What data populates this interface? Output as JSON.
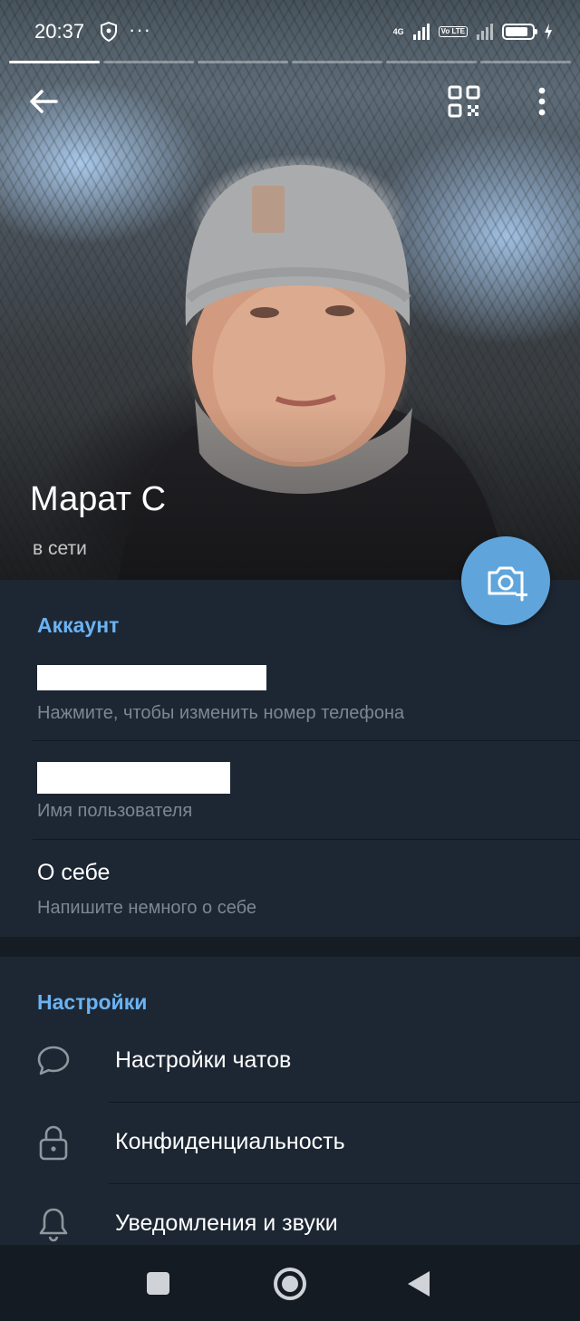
{
  "status_bar": {
    "time": "20:37",
    "more_indicator": "···",
    "network_1": "4G",
    "volte": "Vo LTE",
    "battery_level": 0.85
  },
  "photo_pager": {
    "count": 6,
    "active_index": 0
  },
  "profile": {
    "name": "Марат С",
    "status": "в сети"
  },
  "account": {
    "title": "Аккаунт",
    "phone_hint": "Нажмите, чтобы изменить номер телефона",
    "username_hint": "Имя пользователя",
    "bio_label": "О себе",
    "bio_hint": "Напишите немного о себе"
  },
  "settings": {
    "title": "Настройки",
    "items": [
      {
        "label": "Настройки чатов",
        "icon": "chat-bubble-icon"
      },
      {
        "label": "Конфиденциальность",
        "icon": "lock-icon"
      },
      {
        "label": "Уведомления и звуки",
        "icon": "bell-icon"
      }
    ]
  },
  "icons": {
    "back": "arrow-left-icon",
    "qr": "qr-code-icon",
    "more": "more-vertical-icon",
    "fab": "camera-add-icon"
  },
  "colors": {
    "background": "#1d2733",
    "accent": "#6ab3f3",
    "fab": "#5fa5dc",
    "hint_text": "#7c8791"
  }
}
